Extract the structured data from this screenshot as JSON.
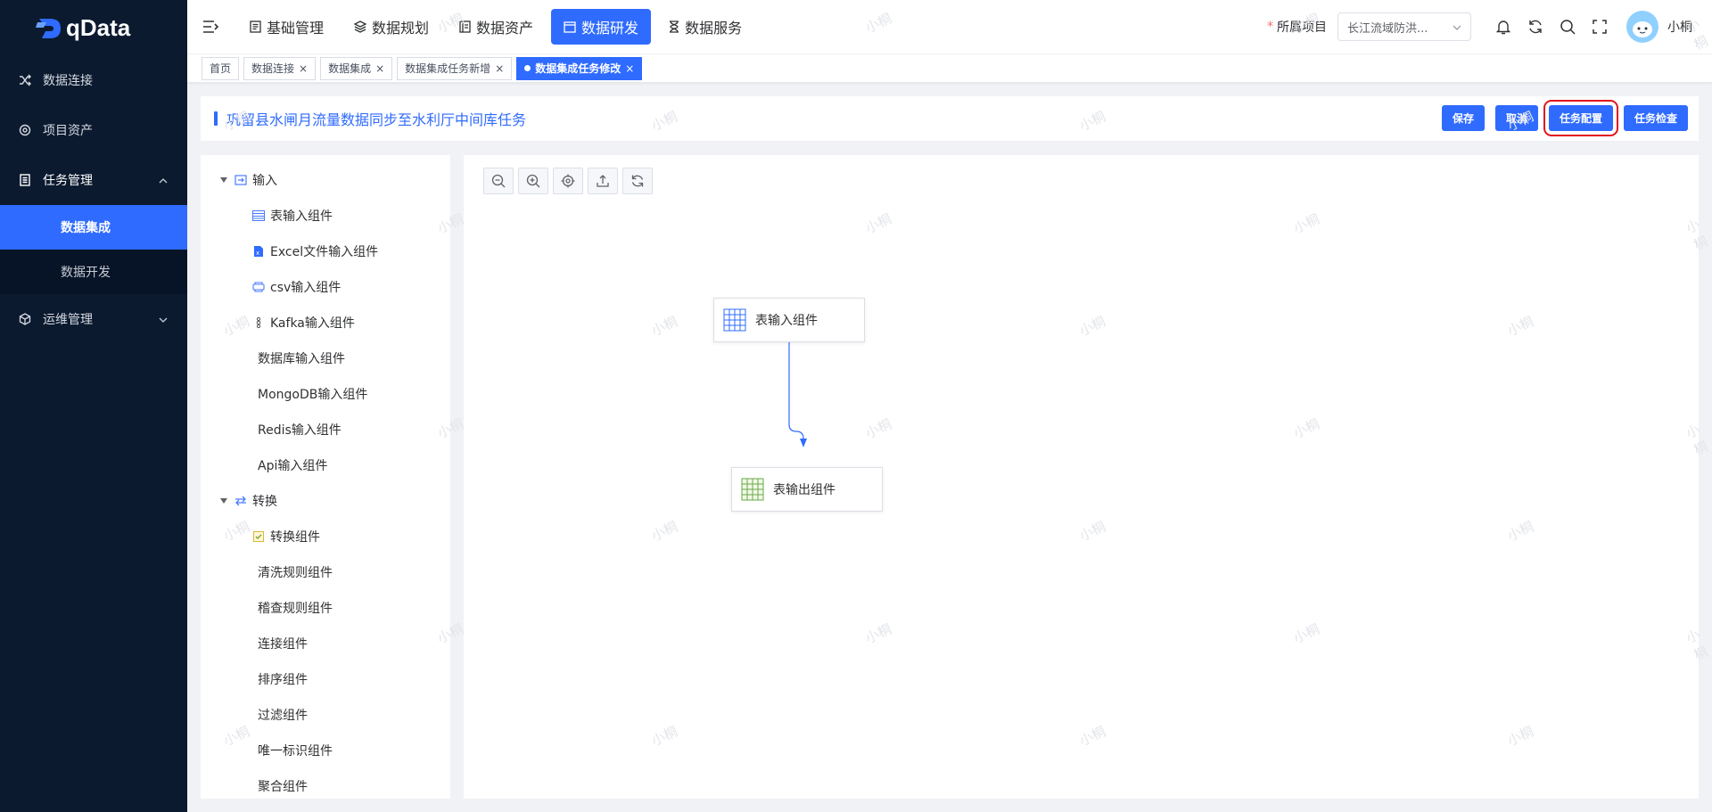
{
  "app": {
    "logo_text": "qData",
    "user_name": "小桐",
    "watermark": "小桐",
    "accent_color": "#2f6bff"
  },
  "sidebar": {
    "items": [
      {
        "label": "数据连接",
        "icon": "shuffle-icon"
      },
      {
        "label": "项目资产",
        "icon": "asset-icon"
      },
      {
        "label": "任务管理",
        "icon": "task-icon",
        "expanded": true,
        "children": [
          {
            "label": "数据集成",
            "active": true
          },
          {
            "label": "数据开发"
          }
        ]
      },
      {
        "label": "运维管理",
        "icon": "cube-icon"
      }
    ]
  },
  "topnav": {
    "tabs": [
      {
        "label": "基础管理",
        "icon": "doc-icon"
      },
      {
        "label": "数据规划",
        "icon": "layers-icon"
      },
      {
        "label": "数据资产",
        "icon": "book-icon"
      },
      {
        "label": "数据研发",
        "icon": "window-icon",
        "active": true
      },
      {
        "label": "数据服务",
        "icon": "hourglass-icon"
      }
    ],
    "project_label": "所属项目",
    "project_value": "长江流域防洪...",
    "required_mark": "*"
  },
  "tags": {
    "items": [
      {
        "label": "首页",
        "closable": false
      },
      {
        "label": "数据连接",
        "closable": true
      },
      {
        "label": "数据集成",
        "closable": true
      },
      {
        "label": "数据集成任务新增",
        "closable": true
      },
      {
        "label": "数据集成任务修改",
        "closable": true,
        "active": true
      }
    ],
    "close_glyph": "×"
  },
  "page": {
    "title": "巩留县水闸月流量数据同步至水利厅中间库任务",
    "buttons": {
      "save": "保存",
      "cancel": "取消",
      "config": "任务配置",
      "check": "任务检查"
    }
  },
  "tree": {
    "groups": [
      {
        "label": "输入",
        "icon": "input-icon",
        "items": [
          {
            "label": "表输入组件",
            "icon": "table-icon"
          },
          {
            "label": "Excel文件输入组件",
            "icon": "excel-icon"
          },
          {
            "label": "csv输入组件",
            "icon": "csv-icon"
          },
          {
            "label": "Kafka输入组件",
            "icon": "kafka-icon"
          },
          {
            "label": "数据库输入组件"
          },
          {
            "label": "MongoDB输入组件"
          },
          {
            "label": "Redis输入组件"
          },
          {
            "label": "Api输入组件"
          }
        ]
      },
      {
        "label": "转换",
        "icon": "transform-icon",
        "items": [
          {
            "label": "转换组件",
            "icon": "convert-icon"
          },
          {
            "label": "清洗规则组件"
          },
          {
            "label": "稽查规则组件"
          },
          {
            "label": "连接组件"
          },
          {
            "label": "排序组件"
          },
          {
            "label": "过滤组件"
          },
          {
            "label": "唯一标识组件"
          },
          {
            "label": "聚合组件"
          }
        ]
      }
    ]
  },
  "canvas": {
    "toolbar": [
      "zoom-out-icon",
      "zoom-in-icon",
      "locate-icon",
      "export-icon",
      "refresh-icon"
    ],
    "nodes": [
      {
        "label": "表输入组件",
        "icon": "table-input-icon"
      },
      {
        "label": "表输出组件",
        "icon": "table-output-icon"
      }
    ]
  }
}
